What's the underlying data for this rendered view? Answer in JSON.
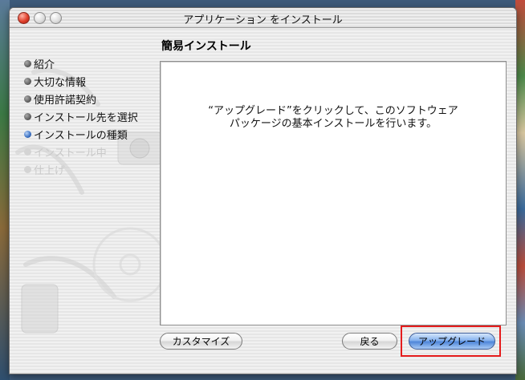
{
  "window": {
    "title": "アプリケーション をインストール"
  },
  "page": {
    "section_title": "簡易インストール",
    "message_line1": "“アップグレード”をクリックして、このソフトウェア",
    "message_line2": "パッケージの基本インストールを行います。"
  },
  "steps": [
    {
      "label": "紹介",
      "state": "done"
    },
    {
      "label": "大切な情報",
      "state": "done"
    },
    {
      "label": "使用許諾契約",
      "state": "done"
    },
    {
      "label": "インストール先を選択",
      "state": "done"
    },
    {
      "label": "インストールの種類",
      "state": "current"
    },
    {
      "label": "インストール中",
      "state": "disabled"
    },
    {
      "label": "仕上げ",
      "state": "disabled"
    }
  ],
  "buttons": {
    "customize": "カスタマイズ",
    "back": "戻る",
    "upgrade": "アップグレード"
  },
  "colors": {
    "highlight": "#e51c1c",
    "default_button": "#4f86d9"
  },
  "icons": {
    "close": "close-icon",
    "minimize": "minimize-icon",
    "zoom": "zoom-icon",
    "step_bullet": "step-bullet-icon"
  }
}
